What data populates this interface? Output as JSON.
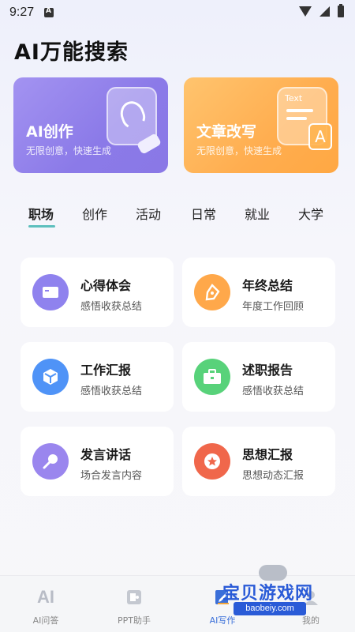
{
  "status": {
    "time": "9:27"
  },
  "page": {
    "title": "AI万能搜索"
  },
  "cards": [
    {
      "title": "AI创作",
      "subtitle": "无限创意，快速生成",
      "icon": "pen-squiggle-icon"
    },
    {
      "title": "文章改写",
      "subtitle": "无限创意，快速生成",
      "art_label": "Text",
      "art_letter": "A",
      "icon": "text-document-icon"
    }
  ],
  "tabs": [
    "职场",
    "创作",
    "活动",
    "日常",
    "就业",
    "大学"
  ],
  "active_tab": 0,
  "tiles": [
    {
      "title": "心得体会",
      "subtitle": "感悟收获总结",
      "icon": "book-icon",
      "color": "#8f82ee"
    },
    {
      "title": "年终总结",
      "subtitle": "年度工作回顾",
      "icon": "pen-nib-icon",
      "color": "#ffa84a"
    },
    {
      "title": "工作汇报",
      "subtitle": "感悟收获总结",
      "icon": "cube-icon",
      "color": "#4f93f7"
    },
    {
      "title": "述职报告",
      "subtitle": "感悟收获总结",
      "icon": "briefcase-icon",
      "color": "#58d27a"
    },
    {
      "title": "发言讲话",
      "subtitle": "场合发言内容",
      "icon": "microphone-icon",
      "color": "#9a86ee"
    },
    {
      "title": "思想汇报",
      "subtitle": "思想动态汇报",
      "icon": "star-badge-icon",
      "color": "#f0674b"
    }
  ],
  "nav": [
    {
      "label": "AI问答",
      "icon": "ai-icon"
    },
    {
      "label": "PPT助手",
      "icon": "ppt-icon"
    },
    {
      "label": "AI写作",
      "icon": "write-icon",
      "active": true
    },
    {
      "label": "我的",
      "icon": "profile-icon"
    }
  ],
  "watermark": {
    "brand": "宝贝游戏网",
    "url": "baobeiy.com"
  },
  "colors": {
    "accent_tab": "#5dbfbd",
    "nav_active": "#3a6fd9"
  }
}
